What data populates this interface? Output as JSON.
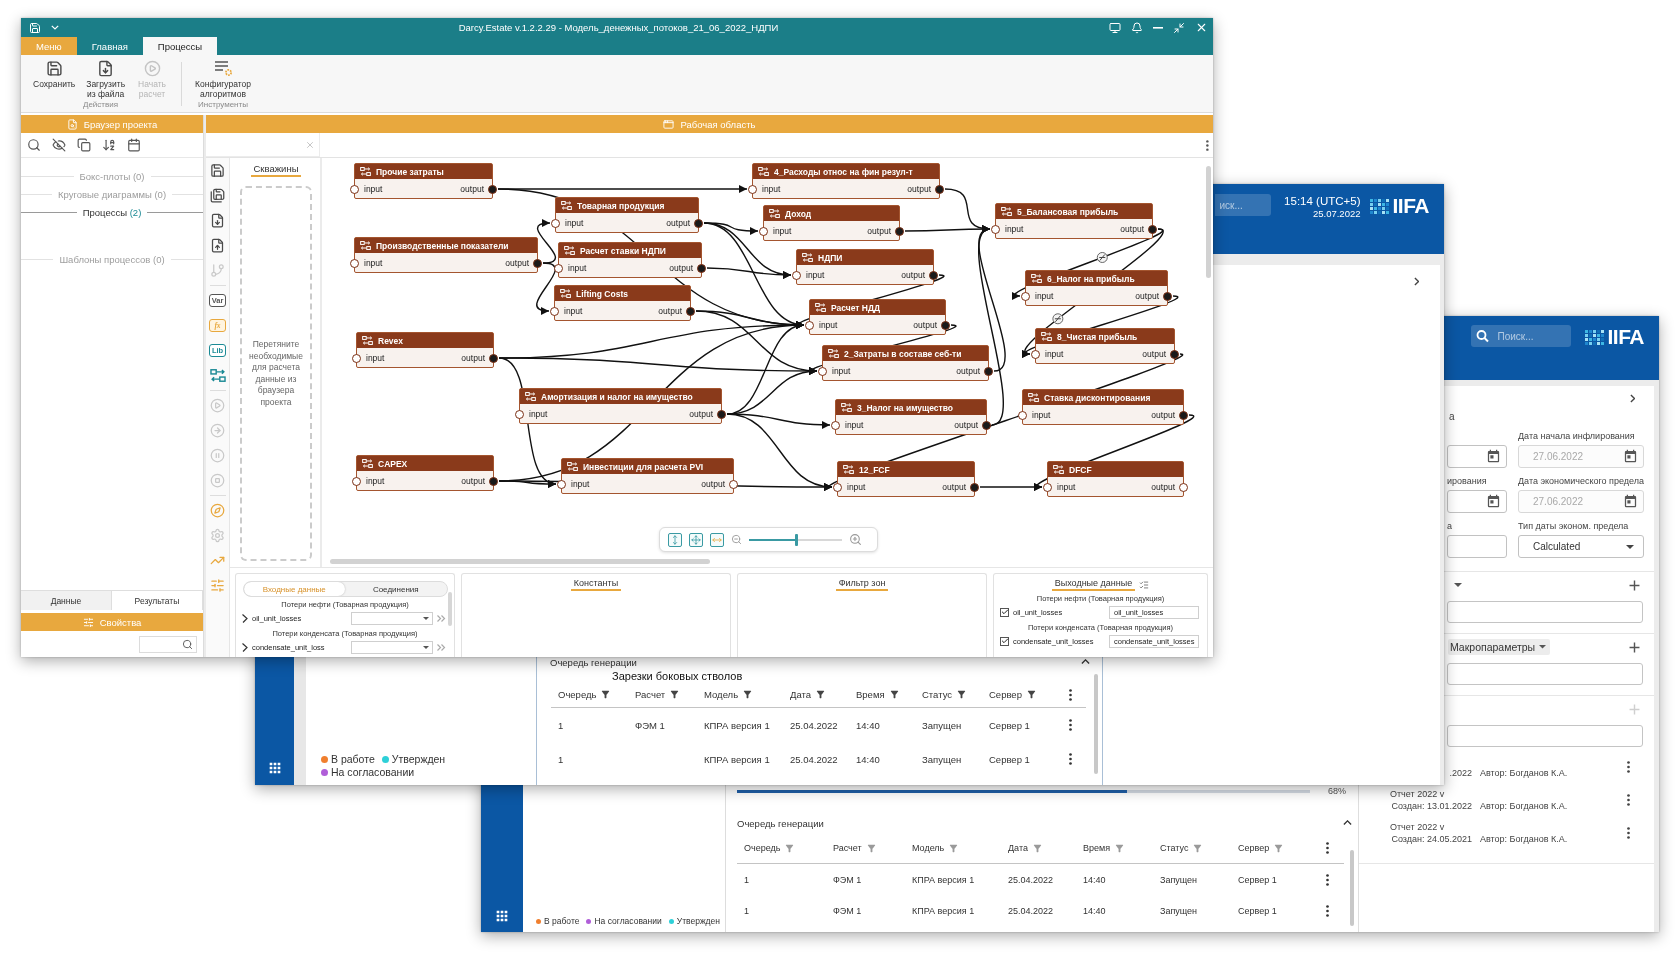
{
  "main_window": {
    "title": "Darcy.Estate v.1.2.2.29 - Модель_денежных_потоков_21_06_2022_НДПИ",
    "ribbon_tabs": [
      {
        "label": "Меню",
        "kind": "menu",
        "selected": false
      },
      {
        "label": "Главная",
        "kind": "tab",
        "selected": false
      },
      {
        "label": "Процессы",
        "kind": "tab",
        "selected": true
      }
    ],
    "ribbon_groups": [
      {
        "label": "Действия",
        "buttons": [
          {
            "label": "Сохранить",
            "kind": "save",
            "disabled": false
          },
          {
            "label": "Загрузить из файла",
            "kind": "load",
            "disabled": false
          },
          {
            "label": "Начать расчет",
            "kind": "run",
            "disabled": true
          }
        ]
      },
      {
        "label": "Инструменты",
        "buttons": [
          {
            "label": "Конфигуратор алгоритмов",
            "kind": "configure",
            "disabled": false
          }
        ]
      }
    ],
    "project_browser": {
      "title": "Браузер проекта",
      "sections": [
        {
          "label": "Бокс-плоты",
          "count": "(0)",
          "active": false
        },
        {
          "label": "Круговые диаграммы",
          "count": "(0)",
          "active": false
        },
        {
          "label": "Процессы",
          "count": "(2)",
          "active": true
        },
        {
          "label": "Шаблоны процессов",
          "count": "(0)",
          "active": false
        }
      ],
      "tabs": [
        {
          "label": "Данные",
          "selected": false
        },
        {
          "label": "Результаты",
          "selected": true
        }
      ]
    },
    "properties": {
      "title": "Свойства"
    },
    "workspace": {
      "title": "Рабочая область",
      "tools": [
        {
          "kind": "save",
          "disabled": false
        },
        {
          "kind": "save_all",
          "disabled": false
        },
        {
          "kind": "import",
          "disabled": false
        },
        {
          "kind": "export",
          "disabled": false
        },
        {
          "kind": "branch",
          "disabled": true
        },
        {
          "kind": "separator"
        },
        {
          "kind": "variable",
          "label": "Var",
          "disabled": false
        },
        {
          "kind": "formula",
          "label": "fx",
          "disabled": false
        },
        {
          "kind": "library",
          "label": "Lib",
          "disabled": false
        },
        {
          "kind": "swap",
          "disabled": false
        },
        {
          "kind": "separator"
        },
        {
          "kind": "play",
          "disabled": true
        },
        {
          "kind": "step",
          "disabled": true
        },
        {
          "kind": "pause",
          "disabled": true
        },
        {
          "kind": "stop",
          "disabled": true
        },
        {
          "kind": "separator"
        },
        {
          "kind": "compass",
          "disabled": false
        },
        {
          "kind": "settings",
          "disabled": true
        },
        {
          "kind": "chart",
          "disabled": false
        },
        {
          "kind": "sliders",
          "disabled": false
        }
      ],
      "wells": {
        "tabs": [
          {
            "label": "Скважины",
            "selected": true
          }
        ],
        "hint": "Перетяните необходимые для расчета данные из браузера проекта"
      },
      "nodes": [
        {
          "title": "Прочие затраты",
          "input": "input",
          "output": "output"
        },
        {
          "title": "4_Расходы относ на фин резул-т",
          "input": "input",
          "output": "output"
        },
        {
          "title": "Товарная продукция",
          "input": "input",
          "output": "output"
        },
        {
          "title": "Доход",
          "input": "input",
          "output": "output"
        },
        {
          "title": "5_Балансовая прибыль",
          "input": "input",
          "output": "output"
        },
        {
          "title": "Производственные показатели",
          "input": "input",
          "output": "output"
        },
        {
          "title": "Расчет ставки НДПИ",
          "input": "input",
          "output": "output"
        },
        {
          "title": "НДПИ",
          "input": "input",
          "output": "output"
        },
        {
          "title": "6_Налог на прибыль",
          "input": "input",
          "output": "output"
        },
        {
          "title": "Lifting Costs",
          "input": "input",
          "output": "output"
        },
        {
          "title": "Расчет НДД",
          "input": "input",
          "output": "output"
        },
        {
          "title": "Revex",
          "input": "input",
          "output": "output"
        },
        {
          "title": "8_Чистая прибыль",
          "input": "input",
          "output": "output"
        },
        {
          "title": "2_Затраты в составе себ-ти",
          "input": "input",
          "output": "output"
        },
        {
          "title": "Амортизация и налог на имущество",
          "input": "input",
          "output": "output"
        },
        {
          "title": "Ставка дисконтирования",
          "input": "input",
          "output": "output"
        },
        {
          "title": "3_Налог на имущество",
          "input": "input",
          "output": "output"
        },
        {
          "title": "CAPEX",
          "input": "input",
          "output": "output"
        },
        {
          "title": "Инвестиции для расчета PVI",
          "input": "input",
          "output": "output"
        },
        {
          "title": "12_FCF",
          "input": "input",
          "output": "output"
        },
        {
          "title": "DFCF",
          "input": "input",
          "output": "output"
        }
      ],
      "zoom": {
        "level": 0.51
      }
    },
    "bottom_panels": {
      "inputs": {
        "tabs": [
          {
            "label": "Входные данные",
            "selected": true
          },
          {
            "label": "Соединения",
            "selected": false
          }
        ],
        "groups": [
          {
            "title": "Потери нефти (Товарная продукция)",
            "param": "oil_unit_losses"
          },
          {
            "title": "Потери конденсата (Товарная продукция)",
            "param": "condensate_unit_loss"
          }
        ]
      },
      "constants": {
        "title": "Константы"
      },
      "zone_filter": {
        "title": "Фильтр зон"
      },
      "outputs": {
        "title": "Выходные данные",
        "groups": [
          {
            "title": "Потери нефти (Товарная продукция)",
            "param": "oil_unit_losses",
            "checked": true,
            "value": "oil_unit_losses"
          },
          {
            "title": "Потери конденсата (Товарная продукция)",
            "param": "condensate_unit_losses",
            "checked": true,
            "value": "condensate_unit_losses"
          }
        ]
      }
    }
  },
  "queue_window": {
    "search": {
      "placeholder": "иск..."
    },
    "time": "15:14 (UTC+5)",
    "date": "25.07.2022",
    "logo": "IIFA",
    "legend": [
      {
        "label": "В работе",
        "color": "#f07f2e"
      },
      {
        "label": "Утвержден",
        "color": "#2ed0d8"
      },
      {
        "label": "На согласовании",
        "color": "#b05ed8"
      }
    ],
    "queue": {
      "title": "Очередь генерации",
      "subtitle": "Зарезки боковых стволов",
      "expanded": true,
      "columns": [
        "Очередь",
        "Расчет",
        "Модель",
        "Дата",
        "Время",
        "Статус",
        "Сервер"
      ],
      "rows": [
        {
          "queue": "1",
          "calculation": "ФЭМ 1",
          "model": "КПРА версия 1",
          "date": "25.04.2022",
          "time": "14:40",
          "status": "Запущен",
          "server": "Сервер 1"
        },
        {
          "queue": "1",
          "model": "КПРА версия 1",
          "date": "25.04.2022",
          "time": "14:40",
          "status": "Запущен",
          "server": "Сервер 1"
        }
      ]
    }
  },
  "parameters_window": {
    "search": {
      "placeholder": "Поиск..."
    },
    "logo": "IIFA",
    "heading": "а",
    "fields": [
      {
        "kind": "date",
        "disabled": false
      },
      {
        "label": "Дата начала инфлирования",
        "kind": "date",
        "value": "27.06.2022",
        "disabled": true
      },
      {
        "label": "ирования",
        "kind": "date",
        "disabled": false
      },
      {
        "label": "Дата экономического предела",
        "kind": "date",
        "value": "27.06.2022",
        "disabled": true
      },
      {
        "label": "а",
        "kind": "text",
        "disabled": false
      },
      {
        "label": "Тип даты эконом. предела",
        "kind": "select",
        "value": "Calculated",
        "disabled": false
      }
    ],
    "sections": [
      {
        "kind": "dropdown",
        "add_disabled": false
      },
      {
        "kind": "chip",
        "label": "Макропараметры",
        "add_disabled": false
      },
      {
        "kind": "plain",
        "add_disabled": true
      }
    ],
    "reports": [
      {
        "created": ".2022",
        "author": "Автор: Богданов К.А."
      },
      {
        "title": "Отчет 2022 v",
        "created": "Создан: 13.01.2022",
        "author": "Автор: Богданов К.А."
      },
      {
        "title": "Отчет 2022 v",
        "created": "Создан: 24.05.2021",
        "author": "Автор: Богданов К.А."
      }
    ],
    "legend": [
      {
        "label": "В работе",
        "color": "#f07f2e"
      },
      {
        "label": "На согласовании",
        "color": "#b05ed8"
      },
      {
        "label": "Утвержден",
        "color": "#2ed0d8"
      }
    ],
    "progress": {
      "level": 0.68,
      "reading": "68%"
    },
    "queue": {
      "title": "Очередь генерации",
      "expanded": true,
      "columns": [
        "Очередь",
        "Расчет",
        "Модель",
        "Дата",
        "Время",
        "Статус",
        "Сервер"
      ],
      "rows": [
        {
          "queue": "1",
          "calculation": "ФЭМ 1",
          "model": "КПРА версия 1",
          "date": "25.04.2022",
          "time": "14:40",
          "status": "Запущен",
          "server": "Сервер 1"
        },
        {
          "queue": "1",
          "calculation": "ФЭМ 1",
          "model": "КПРА версия 1",
          "date": "25.04.2022",
          "time": "14:40",
          "status": "Запущен",
          "server": "Сервер 1"
        }
      ]
    }
  }
}
